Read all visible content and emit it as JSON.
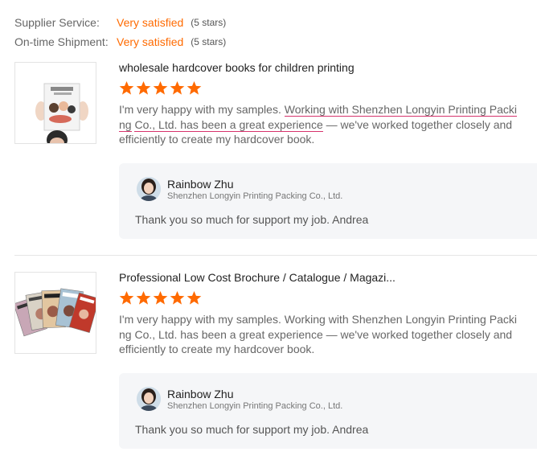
{
  "ratings": [
    {
      "label": "Supplier Service:",
      "value": "Very satisfied",
      "stars": "(5 stars)"
    },
    {
      "label": "On-time Shipment:",
      "value": "Very satisfied",
      "stars": "(5 stars)"
    }
  ],
  "reviews": [
    {
      "product_title": "wholesale hardcover books for children printing",
      "rating": 5,
      "text_before": "I'm very happy with my samples. ",
      "text_highlight_1": "Working with Shenzhen Longyin Printing Packing",
      "text_highlight_2": "Co., Ltd. has been a great experience",
      "text_after": " — we've worked together closely and efficiently to create my hardcover book.",
      "reply": {
        "author": "Rainbow Zhu",
        "company": "Shenzhen Longyin Printing Packing Co., Ltd.",
        "text": "Thank you so much for support my job. Andrea"
      }
    },
    {
      "product_title": "Professional Low Cost Brochure / Catalogue / Magazi...",
      "rating": 5,
      "text": "I'm very happy with my samples. Working with Shenzhen Longyin Printing Packing Co., Ltd. has been a great experience — we've worked together closely and efficiently to create my hardcover book.",
      "reply": {
        "author": "Rainbow Zhu",
        "company": "Shenzhen Longyin Printing Packing Co., Ltd.",
        "text": "Thank you so much for support my job. Andrea"
      }
    }
  ],
  "colors": {
    "accent": "#ff6a00",
    "highlight_underline": "#d6336c",
    "reply_bg": "#f5f6f8"
  },
  "icons": {
    "star": "star-icon",
    "avatar": "avatar-icon"
  }
}
